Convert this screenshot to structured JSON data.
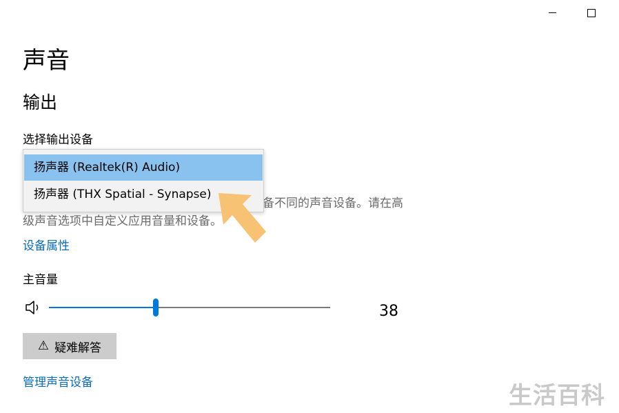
{
  "title": "声音",
  "output_section": {
    "heading": "输出",
    "select_label": "选择输出设备",
    "dropdown": {
      "options": [
        "扬声器 (Realtek(R) Audio)",
        "扬声器 (THX Spatial - Synapse)"
      ],
      "selected_index": 0
    },
    "description_visible": "备不同的声音设备。请在高\n级声音选项中自定义应用音量和设备。",
    "device_properties_link": "设备属性",
    "master_volume_label": "主音量",
    "volume": {
      "value": "38",
      "level_percent": 38,
      "icon": "speaker-icon"
    },
    "troubleshoot_button": {
      "icon": "warning-icon",
      "label": "疑难解答"
    },
    "manage_devices_link": "管理声音设备"
  },
  "window_controls": {
    "minimize_icon": "minimize-icon",
    "maximize_icon": "maximize-icon"
  },
  "watermark": "生活百科",
  "colors": {
    "accent": "#0078d7",
    "link": "#0a6cb8",
    "dropdown_selected": "#8ac2ef",
    "button_bg": "#cccccc",
    "annotation_arrow": "#f7c274"
  }
}
